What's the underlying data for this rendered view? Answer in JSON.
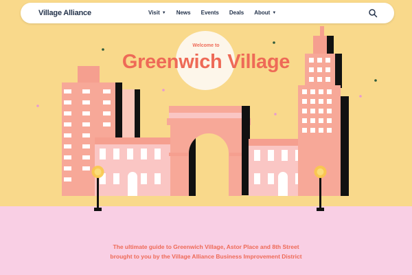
{
  "nav": {
    "brand": "Village Alliance",
    "items": [
      {
        "label": "Visit",
        "dropdown": true
      },
      {
        "label": "News",
        "dropdown": false
      },
      {
        "label": "Events",
        "dropdown": false
      },
      {
        "label": "Deals",
        "dropdown": false
      },
      {
        "label": "About",
        "dropdown": true
      }
    ],
    "search_icon": "search-icon"
  },
  "hero": {
    "welcome": "Welcome to",
    "title": "Greenwich Village"
  },
  "tagline": {
    "line1": "The ultimate guide to Greenwich Village, Astor Place and 8th Street",
    "line2": "brought to you by the Village Alliance Business Improvement District"
  },
  "colors": {
    "sky": "#f9d98b",
    "ground": "#f9cfe4",
    "accent": "#ee6a57",
    "navy": "#23324a"
  }
}
